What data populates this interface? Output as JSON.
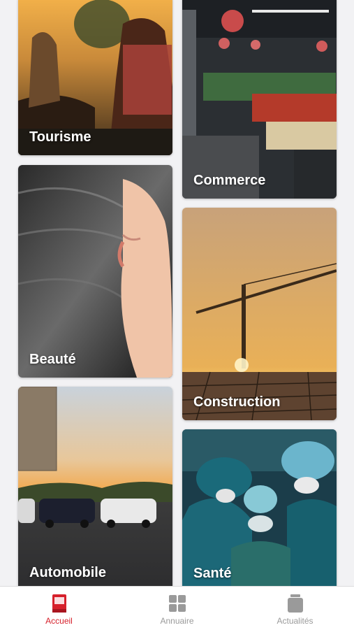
{
  "categories": [
    {
      "id": "tourisme",
      "label": "Tourisme"
    },
    {
      "id": "commerce",
      "label": "Commerce"
    },
    {
      "id": "beaute",
      "label": "Beauté"
    },
    {
      "id": "construction",
      "label": "Construction"
    },
    {
      "id": "automobile",
      "label": "Automobile"
    },
    {
      "id": "sante",
      "label": "Santé"
    }
  ],
  "tabbar": {
    "items": [
      {
        "label": "Accueil",
        "icon": "home-book-icon",
        "active": true
      },
      {
        "label": "Annuaire",
        "icon": "grid-icon",
        "active": false
      },
      {
        "label": "Actualités",
        "icon": "news-jar-icon",
        "active": false
      }
    ],
    "active_color": "#d6202b",
    "inactive_color": "#9a9a9a"
  }
}
